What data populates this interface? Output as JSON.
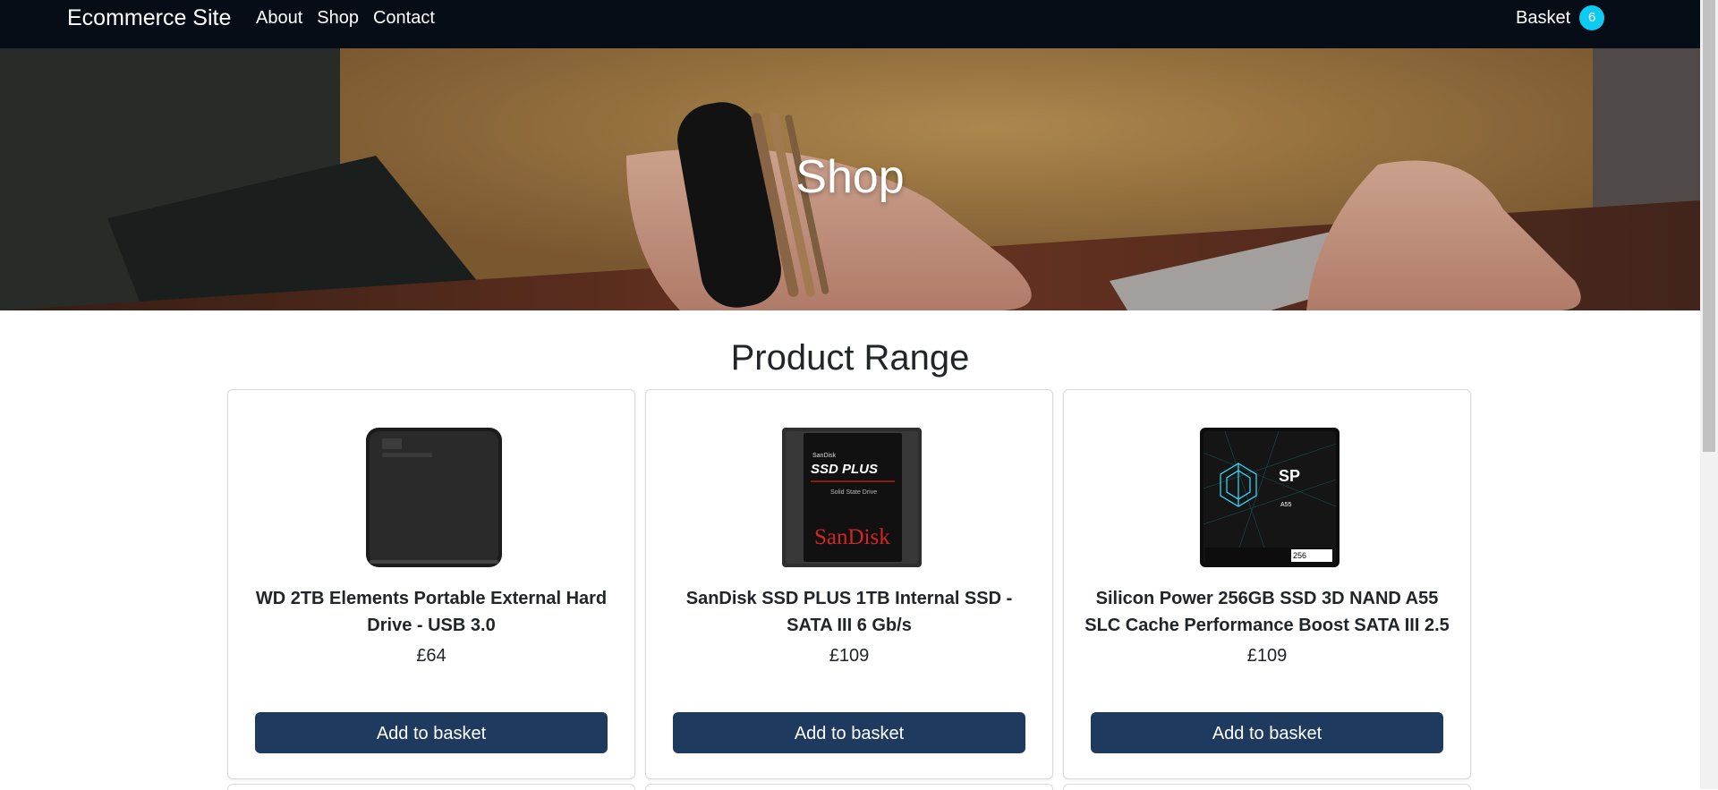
{
  "navbar": {
    "brand": "Ecommerce Site",
    "links": [
      "About",
      "Shop",
      "Contact"
    ],
    "basket_label": "Basket",
    "basket_count": "6"
  },
  "hero": {
    "title": "Shop"
  },
  "section": {
    "title": "Product Range"
  },
  "products": [
    {
      "title": "WD 2TB Elements Portable External Hard Drive - USB 3.0",
      "price": "£64",
      "button": "Add to basket",
      "icon": "external-hard-drive-icon"
    },
    {
      "title": "SanDisk SSD PLUS 1TB Internal SSD - SATA III 6 Gb/s",
      "price": "£109",
      "button": "Add to basket",
      "icon": "sandisk-ssd-icon",
      "image_text": {
        "brand_small": "SanDisk",
        "model": "SSD PLUS",
        "sub": "Solid State Drive",
        "logo": "SanDisk"
      }
    },
    {
      "title": "Silicon Power 256GB SSD 3D NAND A55 SLC Cache Performance Boost SATA III 2.5",
      "price": "£109",
      "button": "Add to basket",
      "icon": "silicon-power-ssd-icon",
      "image_text": {
        "logo": "SP",
        "sub": "A55",
        "capacity": "256"
      }
    }
  ],
  "colors": {
    "navbar": "#070d17",
    "badge": "#0dcaf0",
    "button": "#1f3a5f"
  }
}
